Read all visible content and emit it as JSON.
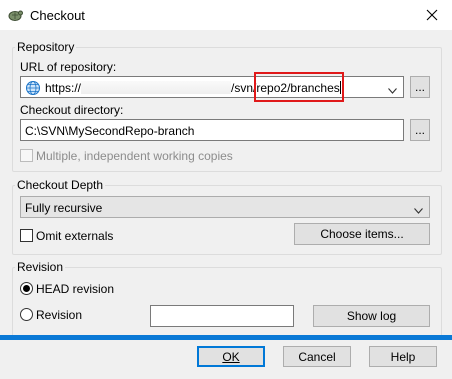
{
  "window": {
    "title": "Checkout"
  },
  "repository": {
    "group_label": "Repository",
    "url_label": "URL of repository:",
    "url_prefix": "https://",
    "url_suffix": "/svn/repo2/branches",
    "dir_label": "Checkout directory:",
    "dir_value": "C:\\SVN\\MySecondRepo-branch",
    "browse_label": "...",
    "multiple_label": "Multiple, independent working copies"
  },
  "depth": {
    "group_label": "Checkout Depth",
    "selected": "Fully recursive",
    "omit_label": "Omit externals",
    "choose_label": "Choose items..."
  },
  "revision": {
    "group_label": "Revision",
    "head_label": "HEAD revision",
    "revision_label": "Revision",
    "revision_value": "",
    "showlog_label": "Show log",
    "selected": "HEAD revision"
  },
  "footer": {
    "ok": "OK",
    "cancel": "Cancel",
    "help": "Help"
  },
  "colors": {
    "accent": "#0a79d6",
    "highlight": "#e0191a"
  }
}
